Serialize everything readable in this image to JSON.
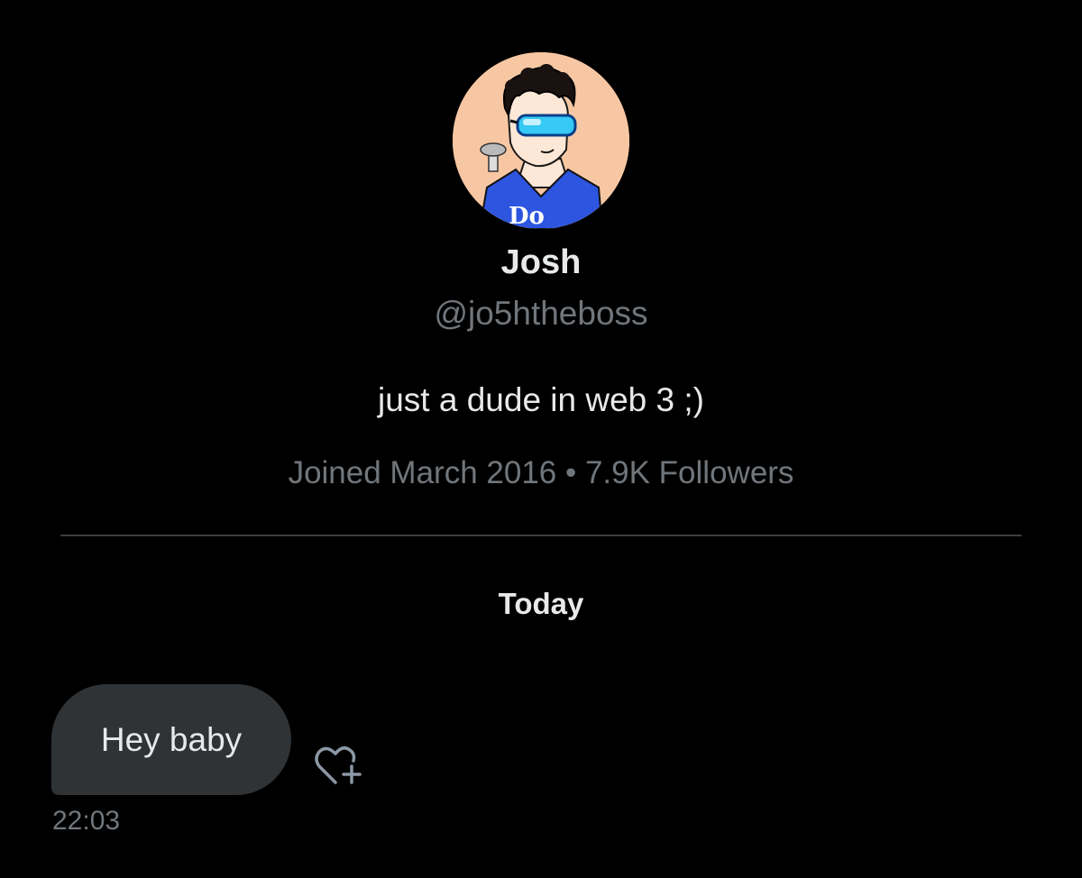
{
  "profile": {
    "display_name": "Josh",
    "handle": "@jo5htheboss",
    "bio": "just a dude in web 3 ;)",
    "meta": "Joined March 2016 • 7.9K Followers",
    "avatar_background": "#f7c7a3",
    "avatar_shirt_text": "Do"
  },
  "conversation": {
    "date_separator": "Today",
    "messages": [
      {
        "text": "Hey baby",
        "time": "22:03",
        "reaction_icon": "heart-plus-icon"
      }
    ]
  },
  "colors": {
    "background": "#000000",
    "primary_text": "#e7e9ea",
    "secondary_text": "#71767b",
    "bubble": "#2f3336",
    "divider": "#3a3e42"
  }
}
